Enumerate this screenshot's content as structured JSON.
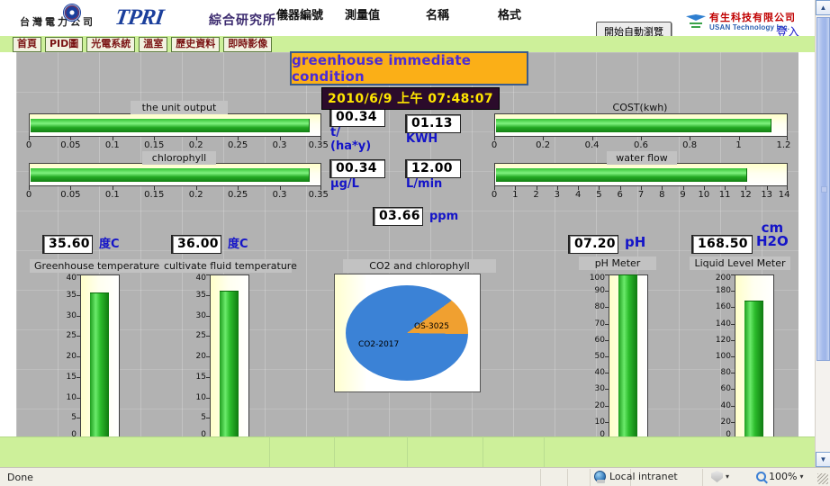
{
  "header": {
    "taipower_label": "台灣電力公司",
    "tpri_logo": "TPRI",
    "institute_name": "綜合研究所",
    "auto_browse_button": "開始自動瀏覽",
    "company_cn": "有生科技有限公司",
    "company_en": "USAN Technology Inc.",
    "login_link": "登入"
  },
  "nav": {
    "items": [
      {
        "label": "首頁"
      },
      {
        "label": "PID圖"
      },
      {
        "label": "光電系統"
      },
      {
        "label": "溫室"
      },
      {
        "label": "歷史資料"
      },
      {
        "label": "即時影像"
      }
    ]
  },
  "banner": {
    "title": "greenhouse immediate condition",
    "datetime": "2010/6/9 上午 07:48:07",
    "bg_color": "#fbaf17",
    "title_color": "#4b2bd6",
    "datetime_color": "#ffe600"
  },
  "readouts": {
    "unit_output": {
      "value": "00.34",
      "unit": "t/\n(ha*y)"
    },
    "kwh": {
      "value": "01.13",
      "unit": "KWH"
    },
    "chlorophyll": {
      "value": "00.34",
      "unit": "µg/L"
    },
    "water_flow": {
      "value": "12.00",
      "unit": "L/min"
    },
    "co2": {
      "value": "03.66",
      "unit": "ppm"
    },
    "greenhouse_temp": {
      "value": "35.60",
      "unit": "度C"
    },
    "fluid_temp": {
      "value": "36.00",
      "unit": "度C"
    },
    "ph": {
      "value": "07.20",
      "unit": "pH"
    },
    "liquid_level": {
      "value": "168.50",
      "unit": "cm\nH2O"
    }
  },
  "chart_data": [
    {
      "type": "bar",
      "orientation": "horizontal",
      "title": "the unit output",
      "categories": [
        "the unit output"
      ],
      "values": [
        0.34
      ],
      "xlim": [
        0,
        0.35
      ],
      "ticks": [
        0,
        0.05,
        0.1,
        0.15,
        0.2,
        0.25,
        0.3,
        0.35
      ],
      "tick_labels": [
        "0",
        "0.05",
        "0.1",
        "0.15",
        "0.2",
        "0.25",
        "0.3",
        "0.35"
      ],
      "xlabel": "",
      "ylabel": "",
      "grid": false,
      "legend": "none",
      "fill_color": "#2cbc2c"
    },
    {
      "type": "bar",
      "orientation": "horizontal",
      "title": "chlorophyll",
      "categories": [
        "chlorophyll"
      ],
      "values": [
        0.34
      ],
      "xlim": [
        0,
        0.35
      ],
      "ticks": [
        0,
        0.05,
        0.1,
        0.15,
        0.2,
        0.25,
        0.3,
        0.35
      ],
      "tick_labels": [
        "0",
        "0.05",
        "0.1",
        "0.15",
        "0.2",
        "0.25",
        "0.3",
        "0.35"
      ],
      "xlabel": "",
      "ylabel": "",
      "grid": false,
      "legend": "none",
      "fill_color": "#2cbc2c"
    },
    {
      "type": "bar",
      "orientation": "horizontal",
      "title": "COST(kwh)",
      "categories": [
        "COST(kwh)"
      ],
      "values": [
        1.13
      ],
      "xlim": [
        0,
        1.2
      ],
      "ticks": [
        0,
        0.2,
        0.4,
        0.6,
        0.8,
        1,
        1.2
      ],
      "tick_labels": [
        "0",
        "0.2",
        "0.4",
        "0.6",
        "0.8",
        "1",
        "1.2"
      ],
      "xlabel": "",
      "ylabel": "",
      "grid": false,
      "legend": "none",
      "fill_color": "#2cbc2c"
    },
    {
      "type": "bar",
      "orientation": "horizontal",
      "title": "water flow",
      "categories": [
        "water flow"
      ],
      "values": [
        12.0
      ],
      "xlim": [
        0,
        14
      ],
      "ticks": [
        0,
        1,
        2,
        3,
        4,
        5,
        6,
        7,
        8,
        9,
        10,
        11,
        12,
        13,
        14
      ],
      "tick_labels": [
        "0",
        "1",
        "2",
        "3",
        "4",
        "5",
        "6",
        "7",
        "8",
        "9",
        "10",
        "11",
        "12",
        "13",
        "14"
      ],
      "xlabel": "",
      "ylabel": "",
      "grid": false,
      "legend": "none",
      "fill_color": "#2cbc2c"
    },
    {
      "type": "bar",
      "orientation": "vertical",
      "title": "Greenhouse temperature",
      "categories": [
        "Greenhouse temperature"
      ],
      "values": [
        35.6
      ],
      "ylim": [
        0,
        40
      ],
      "ticks": [
        0,
        5,
        10,
        15,
        20,
        25,
        30,
        35,
        40
      ],
      "tick_labels": [
        "0",
        "5",
        "10",
        "15",
        "20",
        "25",
        "30",
        "35",
        "40"
      ],
      "xlabel": "",
      "ylabel": "",
      "grid": false,
      "legend": "none",
      "fill_color": "#2cbc2c"
    },
    {
      "type": "bar",
      "orientation": "vertical",
      "title": "cultivate fluid temperature",
      "categories": [
        "cultivate fluid temperature"
      ],
      "values": [
        36.0
      ],
      "ylim": [
        0,
        40
      ],
      "ticks": [
        0,
        5,
        10,
        15,
        20,
        25,
        30,
        35,
        40
      ],
      "tick_labels": [
        "0",
        "5",
        "10",
        "15",
        "20",
        "25",
        "30",
        "35",
        "40"
      ],
      "xlabel": "",
      "ylabel": "",
      "grid": false,
      "legend": "none",
      "fill_color": "#2cbc2c"
    },
    {
      "type": "pie",
      "title": "CO2 and chlorophyll",
      "labels": [
        "CO2-2017",
        "OS-3025"
      ],
      "values": [
        89.7,
        10.3
      ],
      "colors": [
        "#3b82d6",
        "#f0a030"
      ],
      "legend": "inline"
    },
    {
      "type": "bar",
      "orientation": "vertical",
      "title": "pH Meter",
      "categories": [
        "pH Meter"
      ],
      "values": [
        100
      ],
      "ylim": [
        0,
        100
      ],
      "ticks": [
        0,
        10,
        20,
        30,
        40,
        50,
        60,
        70,
        80,
        90,
        100
      ],
      "tick_labels": [
        "0",
        "10",
        "20",
        "30",
        "40",
        "50",
        "60",
        "70",
        "80",
        "90",
        "100"
      ],
      "xlabel": "",
      "ylabel": "",
      "grid": false,
      "legend": "none",
      "fill_color": "#2cbc2c"
    },
    {
      "type": "bar",
      "orientation": "vertical",
      "title": "Liquid Level Meter",
      "categories": [
        "Liquid Level Meter"
      ],
      "values": [
        168.5
      ],
      "ylim": [
        0,
        200
      ],
      "ticks": [
        0,
        20,
        40,
        60,
        80,
        100,
        120,
        140,
        160,
        180,
        200
      ],
      "tick_labels": [
        "0",
        "20",
        "40",
        "60",
        "80",
        "100",
        "120",
        "140",
        "160",
        "180",
        "200"
      ],
      "xlabel": "",
      "ylabel": "",
      "grid": false,
      "legend": "none",
      "fill_color": "#2cbc2c"
    }
  ],
  "bottom_table": {
    "headers": [
      "儀器編號",
      "測量值",
      "名稱",
      "格式"
    ]
  },
  "statusbar": {
    "message": "Done",
    "zone": "Local intranet",
    "zoom": "100%"
  }
}
